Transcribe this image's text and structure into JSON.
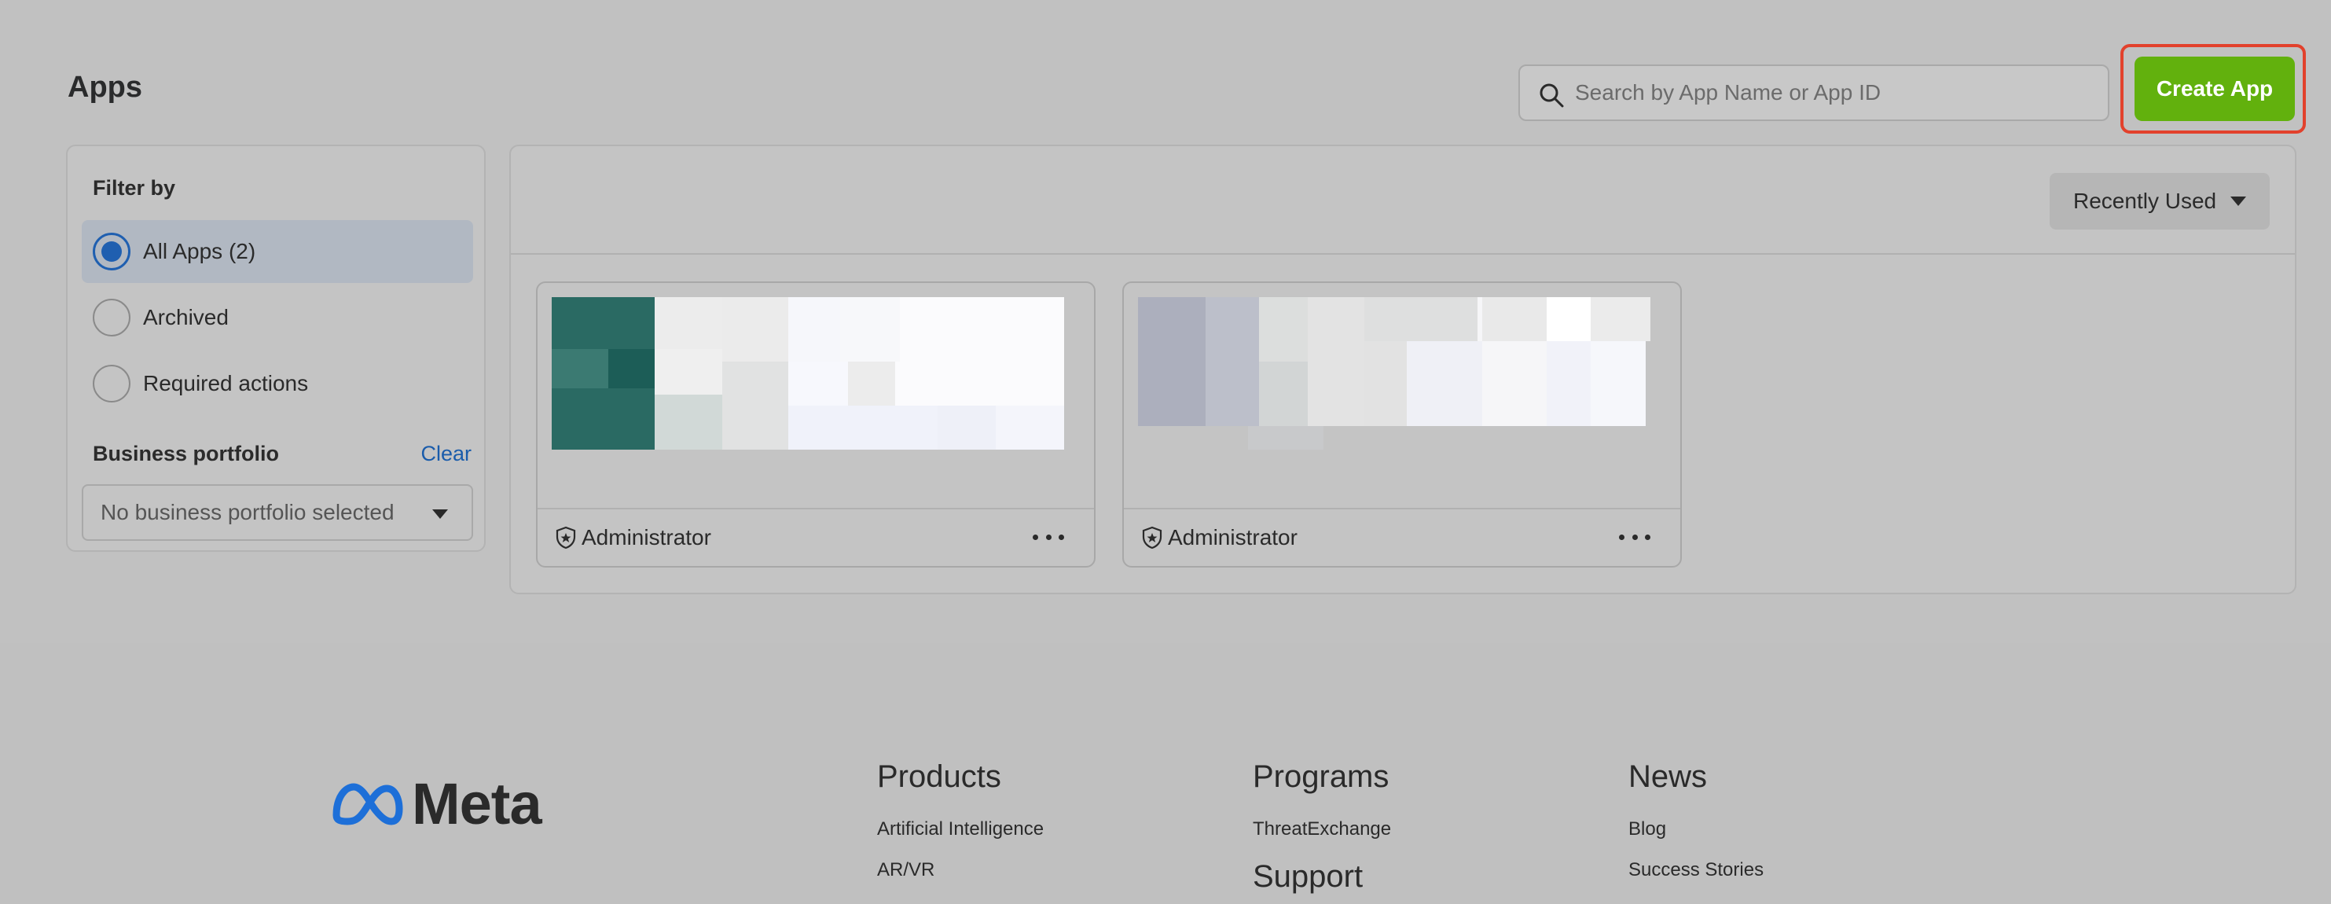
{
  "page": {
    "title": "Apps"
  },
  "search": {
    "placeholder": "Search by App Name or App ID",
    "value": ""
  },
  "create_button": {
    "label": "Create App",
    "color": "#62b10d"
  },
  "filter": {
    "title": "Filter by",
    "options": [
      {
        "label": "All Apps (2)",
        "selected": true
      },
      {
        "label": "Archived",
        "selected": false
      },
      {
        "label": "Required actions",
        "selected": false
      }
    ],
    "portfolio_title": "Business portfolio",
    "clear_label": "Clear",
    "portfolio_select": "No business portfolio selected"
  },
  "sort": {
    "label": "Recently Used"
  },
  "apps": [
    {
      "role": "Administrator"
    },
    {
      "role": "Administrator"
    }
  ],
  "footer": {
    "brand": "Meta",
    "columns": [
      {
        "heading": "Products",
        "links": [
          "Artificial Intelligence",
          "AR/VR"
        ]
      },
      {
        "heading": "Programs",
        "links": [
          "ThreatExchange"
        ],
        "heading2": "Support"
      },
      {
        "heading": "News",
        "links": [
          "Blog",
          "Success Stories"
        ]
      }
    ]
  },
  "colors": {
    "accent": "#1f5fb0",
    "highlight": "#e2412c",
    "link": "#1a5cab"
  }
}
